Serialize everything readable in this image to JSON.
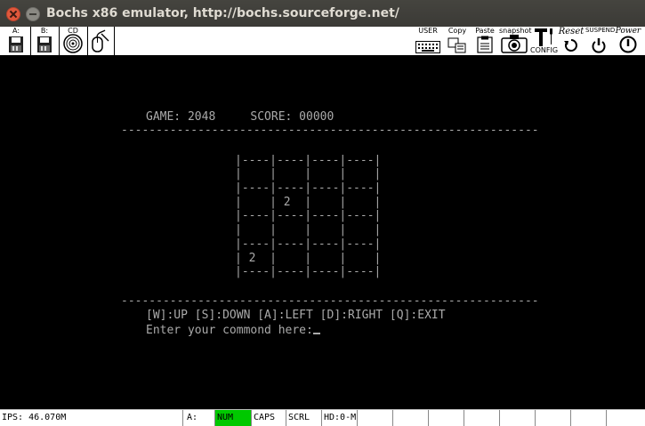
{
  "window": {
    "title": "Bochs x86 emulator, http://bochs.sourceforge.net/"
  },
  "toolbar": {
    "floppy_a": "A:",
    "floppy_b": "B:",
    "cdrom": "CD",
    "user": "USER",
    "copy": "Copy",
    "paste": "Paste",
    "snapshot": "snapshot",
    "config": "CONFIG",
    "reset": "Reset",
    "suspend": "SUSPEND",
    "power": "Power"
  },
  "screen": {
    "header": "GAME: 2048     SCORE: 00000",
    "separator": "------------------------------------------------------------",
    "board": [
      "|----|----|----|----|",
      "|    |    |    |    |",
      "|----|----|----|----|",
      "|    | 2  |    |    |",
      "|----|----|----|----|",
      "|    |    |    |    |",
      "|----|----|----|----|",
      "| 2  |    |    |    |",
      "|----|----|----|----|"
    ],
    "controls": "[W]:UP [S]:DOWN [A]:LEFT [D]:RIGHT [Q]:EXIT",
    "prompt": "Enter your commond here:"
  },
  "statusbar": {
    "ips": "IPS: 46.070M",
    "floppy": "A:",
    "num": "NUM",
    "caps": "CAPS",
    "scrl": "SCRL",
    "hd": "HD:0-M"
  },
  "colors": {
    "screen_text": "#aaaaaa",
    "num_active": "#00c800",
    "close_button": "#e0583c"
  }
}
